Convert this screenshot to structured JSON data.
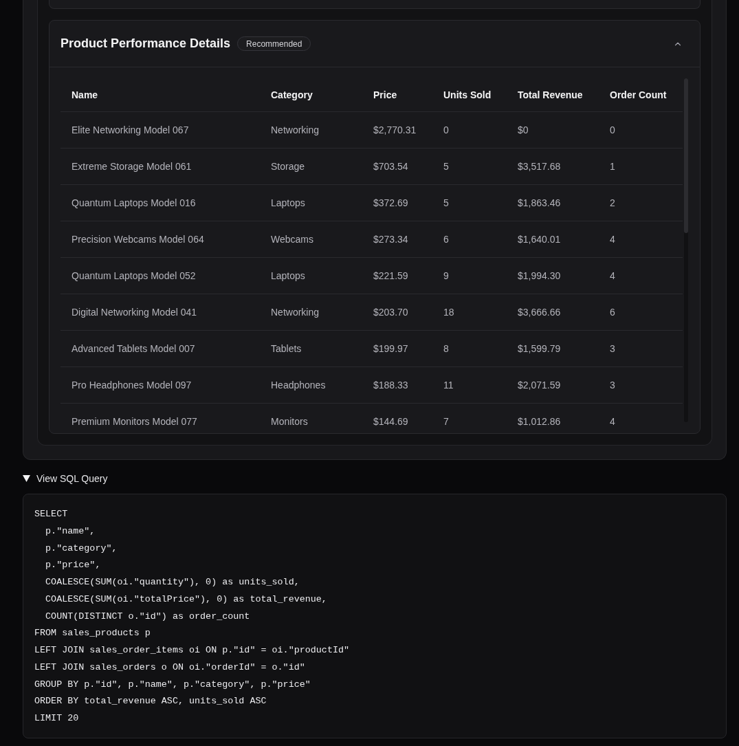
{
  "product_card": {
    "title": "Product Performance Details",
    "badge": "Recommended",
    "expanded": true,
    "table": {
      "columns": [
        "Name",
        "Category",
        "Price",
        "Units Sold",
        "Total Revenue",
        "Order Count"
      ],
      "rows": [
        [
          "Elite Networking Model 067",
          "Networking",
          "$2,770.31",
          "0",
          "$0",
          "0"
        ],
        [
          "Extreme Storage Model 061",
          "Storage",
          "$703.54",
          "5",
          "$3,517.68",
          "1"
        ],
        [
          "Quantum Laptops Model 016",
          "Laptops",
          "$372.69",
          "5",
          "$1,863.46",
          "2"
        ],
        [
          "Precision Webcams Model 064",
          "Webcams",
          "$273.34",
          "6",
          "$1,640.01",
          "4"
        ],
        [
          "Quantum Laptops Model 052",
          "Laptops",
          "$221.59",
          "9",
          "$1,994.30",
          "4"
        ],
        [
          "Digital Networking Model 041",
          "Networking",
          "$203.70",
          "18",
          "$3,666.66",
          "6"
        ],
        [
          "Advanced Tablets Model 007",
          "Tablets",
          "$199.97",
          "8",
          "$1,599.79",
          "3"
        ],
        [
          "Pro Headphones Model 097",
          "Headphones",
          "$188.33",
          "11",
          "$2,071.59",
          "3"
        ],
        [
          "Premium Monitors Model 077",
          "Monitors",
          "$144.69",
          "7",
          "$1,012.86",
          "4"
        ]
      ]
    }
  },
  "sql_query": {
    "label": "View SQL Query",
    "expanded": true,
    "code": [
      "SELECT",
      "  p.\"name\",",
      "  p.\"category\",",
      "  p.\"price\",",
      "  COALESCE(SUM(oi.\"quantity\"), 0) as units_sold,",
      "  COALESCE(SUM(oi.\"totalPrice\"), 0) as total_revenue,",
      "  COUNT(DISTINCT o.\"id\") as order_count",
      "FROM sales_products p",
      "LEFT JOIN sales_order_items oi ON p.\"id\" = oi.\"productId\"",
      "LEFT JOIN sales_orders o ON oi.\"orderId\" = o.\"id\"",
      "GROUP BY p.\"id\", p.\"name\", p.\"category\", p.\"price\"",
      "ORDER BY total_revenue ASC, units_sold ASC",
      "LIMIT 20"
    ]
  }
}
